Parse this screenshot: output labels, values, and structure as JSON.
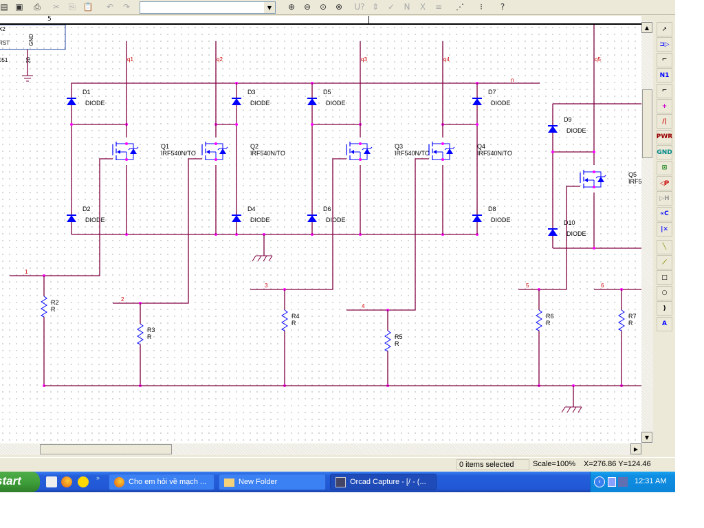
{
  "toolbar": {
    "part_combo_value": "",
    "icons": [
      "open-icon",
      "save-icon",
      "print-icon",
      "cut-icon",
      "copy-icon",
      "paste-icon",
      "undo-icon",
      "redo-icon",
      "zoom-in-icon",
      "zoom-out-icon",
      "zoom-area-icon",
      "zoom-all-icon",
      "annotate-icon",
      "back-annotate-icon",
      "drc-icon",
      "netlist-icon",
      "cross-ref-icon",
      "bom-icon",
      "snap-grid-icon",
      "project-manager-icon",
      "help-icon"
    ]
  },
  "ruler": {
    "label": "5"
  },
  "right_toolbar": {
    "items": [
      {
        "icon": "select-icon",
        "label": "➚"
      },
      {
        "icon": "place-part-icon",
        "label": "⊐▷"
      },
      {
        "icon": "place-wire-icon",
        "label": "⌐"
      },
      {
        "icon": "net-alias-icon",
        "label": "N1"
      },
      {
        "icon": "place-bus-icon",
        "label": "⌐"
      },
      {
        "icon": "junction-icon",
        "label": "+"
      },
      {
        "icon": "bus-entry-icon",
        "label": "/|"
      },
      {
        "icon": "power-icon",
        "label": "PWR"
      },
      {
        "icon": "ground-icon",
        "label": "GND"
      },
      {
        "icon": "hierarchical-block-icon",
        "label": "⊡"
      },
      {
        "icon": "hierarchical-port-icon",
        "label": "◁P"
      },
      {
        "icon": "hierarchical-pin-icon",
        "label": "▷H"
      },
      {
        "icon": "off-page-connector-icon",
        "label": "«C"
      },
      {
        "icon": "no-connect-icon",
        "label": "|✕"
      },
      {
        "icon": "line-icon",
        "label": "╲"
      },
      {
        "icon": "polyline-icon",
        "label": "⟋"
      },
      {
        "icon": "rectangle-icon",
        "label": "□"
      },
      {
        "icon": "ellipse-icon",
        "label": "○"
      },
      {
        "icon": "arc-icon",
        "label": ")"
      },
      {
        "icon": "text-icon",
        "label": "A"
      }
    ]
  },
  "schematic": {
    "ic": {
      "pin_x2": "X2",
      "pin_rst": "RST",
      "pin_gnd": "GND",
      "part_suffix": "051",
      "pin_number": "20"
    },
    "nets": {
      "q1": "q1",
      "q2": "q2",
      "q3": "q3",
      "q4": "q4",
      "q5": "q5",
      "n": "n",
      "n1": "1",
      "n2": "2",
      "n3": "3",
      "n4": "4",
      "n5": "5",
      "n6": "6"
    },
    "diodes": [
      {
        "ref": "D1",
        "value": "DIODE"
      },
      {
        "ref": "D2",
        "value": "DIODE"
      },
      {
        "ref": "D3",
        "value": "DIODE"
      },
      {
        "ref": "D4",
        "value": "DIODE"
      },
      {
        "ref": "D5",
        "value": "DIODE"
      },
      {
        "ref": "D6",
        "value": "DIODE"
      },
      {
        "ref": "D7",
        "value": "DIODE"
      },
      {
        "ref": "D8",
        "value": "DIODE"
      },
      {
        "ref": "D9",
        "value": "DIODE"
      },
      {
        "ref": "D10",
        "value": "DIODE"
      }
    ],
    "mosfets": [
      {
        "ref": "Q1",
        "value": "IRF540N/TO"
      },
      {
        "ref": "Q2",
        "value": "IRF540N/TO"
      },
      {
        "ref": "Q3",
        "value": "IRF540N/TO"
      },
      {
        "ref": "Q4",
        "value": "IRF540N/TO"
      },
      {
        "ref": "Q5",
        "value": "IRF5"
      }
    ],
    "resistors": [
      {
        "ref": "R2",
        "value": "R"
      },
      {
        "ref": "R3",
        "value": "R"
      },
      {
        "ref": "R4",
        "value": "R"
      },
      {
        "ref": "R5",
        "value": "R"
      },
      {
        "ref": "R6",
        "value": "R"
      },
      {
        "ref": "R7",
        "value": "R"
      }
    ],
    "colors": {
      "wire": "#800040",
      "part": "#0000ff",
      "junction": "#ff00ff",
      "net_label": "#cc0000"
    }
  },
  "status": {
    "selection": "0 items selected",
    "scale": "Scale=100%",
    "coords": "X=276.86  Y=124.46"
  },
  "taskbar": {
    "start": "start",
    "quick_launch": [
      "notepad-icon",
      "firefox-icon",
      "messenger-icon"
    ],
    "tasks": [
      {
        "label": "Cho em hỏi về mạch ...",
        "icon": "firefox-icon"
      },
      {
        "label": "New Folder",
        "icon": "folder-icon"
      },
      {
        "label": "Orcad Capture - [/ - (...",
        "icon": "orcad-icon",
        "active": true
      }
    ],
    "clock": "12:31 AM"
  }
}
